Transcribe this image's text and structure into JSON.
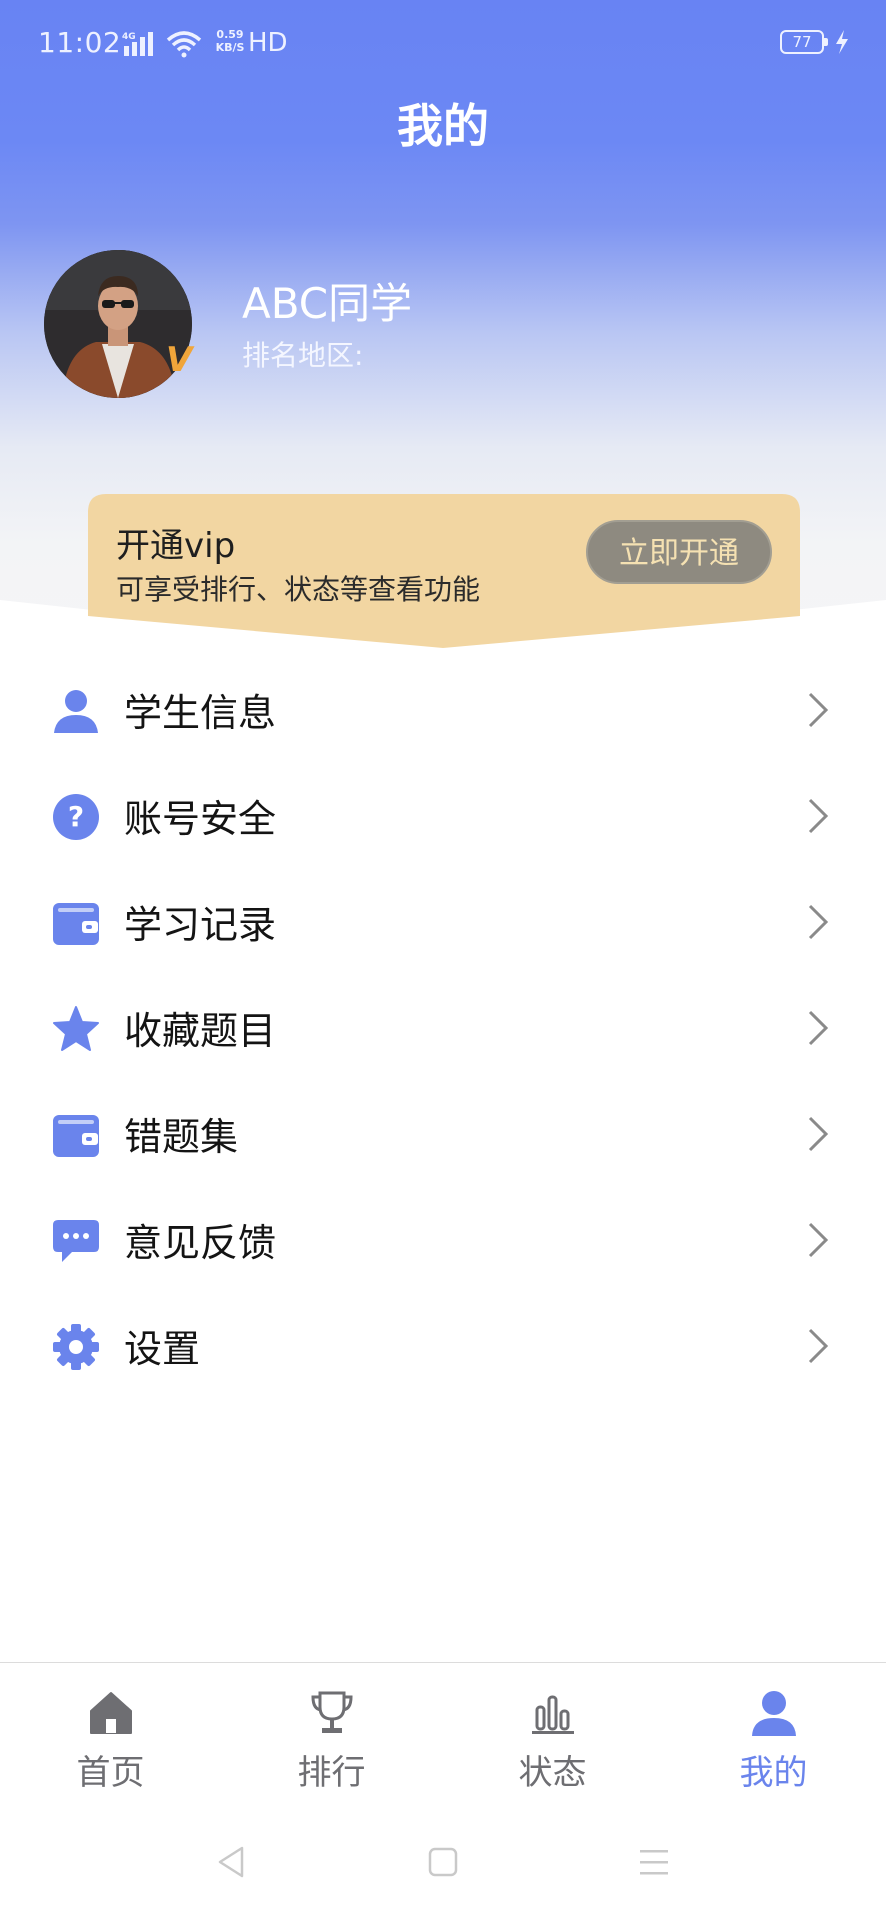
{
  "status_bar": {
    "time": "11:02",
    "network": "4G",
    "speed_top": "0.59",
    "speed_bottom": "KB/S",
    "hd": "HD",
    "battery": "77"
  },
  "page": {
    "title": "我的"
  },
  "profile": {
    "username": "ABC同学",
    "region_label": "排名地区:",
    "vip_badge": "V"
  },
  "vip": {
    "title": "开通vip",
    "description": "可享受排行、状态等查看功能",
    "button_label": "立即开通"
  },
  "menu": {
    "items": [
      {
        "label": "学生信息",
        "icon": "user-icon"
      },
      {
        "label": "账号安全",
        "icon": "question-circle-icon"
      },
      {
        "label": "学习记录",
        "icon": "wallet-icon"
      },
      {
        "label": "收藏题目",
        "icon": "star-icon"
      },
      {
        "label": "错题集",
        "icon": "wallet-icon"
      },
      {
        "label": "意见反馈",
        "icon": "chat-bubble-icon"
      },
      {
        "label": "设置",
        "icon": "gear-icon"
      }
    ]
  },
  "bottom_nav": {
    "items": [
      {
        "label": "首页",
        "icon": "home-icon"
      },
      {
        "label": "排行",
        "icon": "trophy-icon"
      },
      {
        "label": "状态",
        "icon": "bar-chart-icon"
      },
      {
        "label": "我的",
        "icon": "user-icon"
      }
    ],
    "active_index": 3
  },
  "colors": {
    "accent": "#6a84ec",
    "header_top": "#6883f3",
    "vip_banner": "#f2d6a2",
    "vip_button": "#8e8a80"
  }
}
